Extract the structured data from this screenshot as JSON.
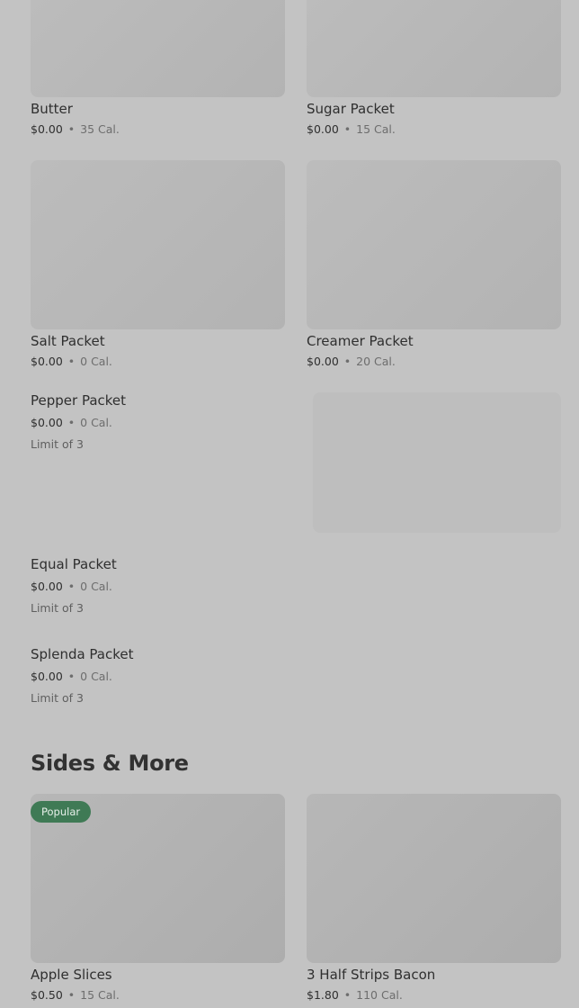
{
  "items": [
    {
      "name": "Butter",
      "price": "$0.00",
      "sep": "•",
      "cal": "35 Cal."
    },
    {
      "name": "Sugar Packet",
      "price": "$0.00",
      "sep": "•",
      "cal": "15 Cal."
    },
    {
      "name": "Salt Packet",
      "price": "$0.00",
      "sep": "•",
      "cal": "0 Cal."
    },
    {
      "name": "Creamer Packet",
      "price": "$0.00",
      "sep": "•",
      "cal": "20 Cal."
    },
    {
      "name": "Pepper Packet",
      "price": "$0.00",
      "sep": "•",
      "cal": "0 Cal.",
      "limit": "Limit of 3"
    },
    {
      "name": "Equal Packet",
      "price": "$0.00",
      "sep": "•",
      "cal": "0 Cal.",
      "limit": "Limit of 3"
    },
    {
      "name": "Splenda Packet",
      "price": "$0.00",
      "sep": "•",
      "cal": "0 Cal.",
      "limit": "Limit of 3"
    }
  ],
  "sides_section": {
    "title": "Sides & More",
    "items": [
      {
        "name": "Apple Slices",
        "price": "$0.50",
        "sep": "•",
        "cal": "15 Cal.",
        "badge": "Popular"
      },
      {
        "name": "3 Half Strips Bacon",
        "price": "$1.80",
        "sep": "•",
        "cal": "110 Cal."
      }
    ]
  },
  "colors": {
    "background": "#c3c3c3",
    "tile": "#b5b5b5",
    "badge": "#3f7a55"
  }
}
